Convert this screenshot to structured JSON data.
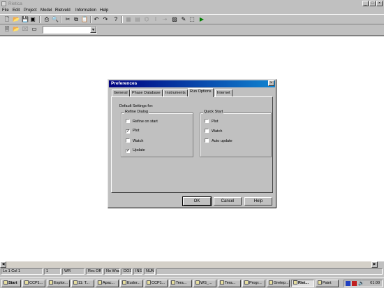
{
  "app": {
    "title": "Rietica"
  },
  "menu": [
    "File",
    "Edit",
    "Project",
    "Model",
    "Rietveld",
    "Information",
    "Help"
  ],
  "dialog": {
    "title": "Preferences",
    "tabs": [
      "General",
      "Phase Database",
      "Instruments",
      "Run Options",
      "Internet"
    ],
    "active_tab": "Run Options",
    "heading": "Default Settings for:",
    "refine_group": {
      "label": "Refine Dialog",
      "options": [
        {
          "label": "Refine on start",
          "checked": false
        },
        {
          "label": "Plot",
          "checked": true
        },
        {
          "label": "Watch",
          "checked": false
        },
        {
          "label": "Update",
          "checked": true
        }
      ]
    },
    "quick_group": {
      "label": "Quick Start",
      "options": [
        {
          "label": "Plot",
          "checked": false
        },
        {
          "label": "Watch",
          "checked": false
        },
        {
          "label": "Auto update",
          "checked": false
        }
      ]
    },
    "buttons": {
      "ok": "OK",
      "cancel": "Cancel",
      "help": "Help"
    }
  },
  "statusbar": {
    "position": "Ln 1 Col 1",
    "count": "1",
    "wr": "WR",
    "rec": "Rec Off",
    "wrap": "No Wrap",
    "dos": "DOS",
    "ins": "INS",
    "num": "NUM"
  },
  "taskbar": {
    "start": "Start",
    "tasks": [
      "CCP1...",
      "Explor...",
      "11: T...",
      "Apac...",
      "Eudor...",
      "CCP1...",
      "Tera...",
      "WS_...",
      "Tera...",
      "Progr...",
      "Gretep...",
      "Riet...",
      "Paint"
    ],
    "active_task": "Riet...",
    "clock": "01:00"
  },
  "colors": {
    "titlebar_start": "#000080",
    "titlebar_end": "#1084d0",
    "run_icon": "#008000"
  }
}
